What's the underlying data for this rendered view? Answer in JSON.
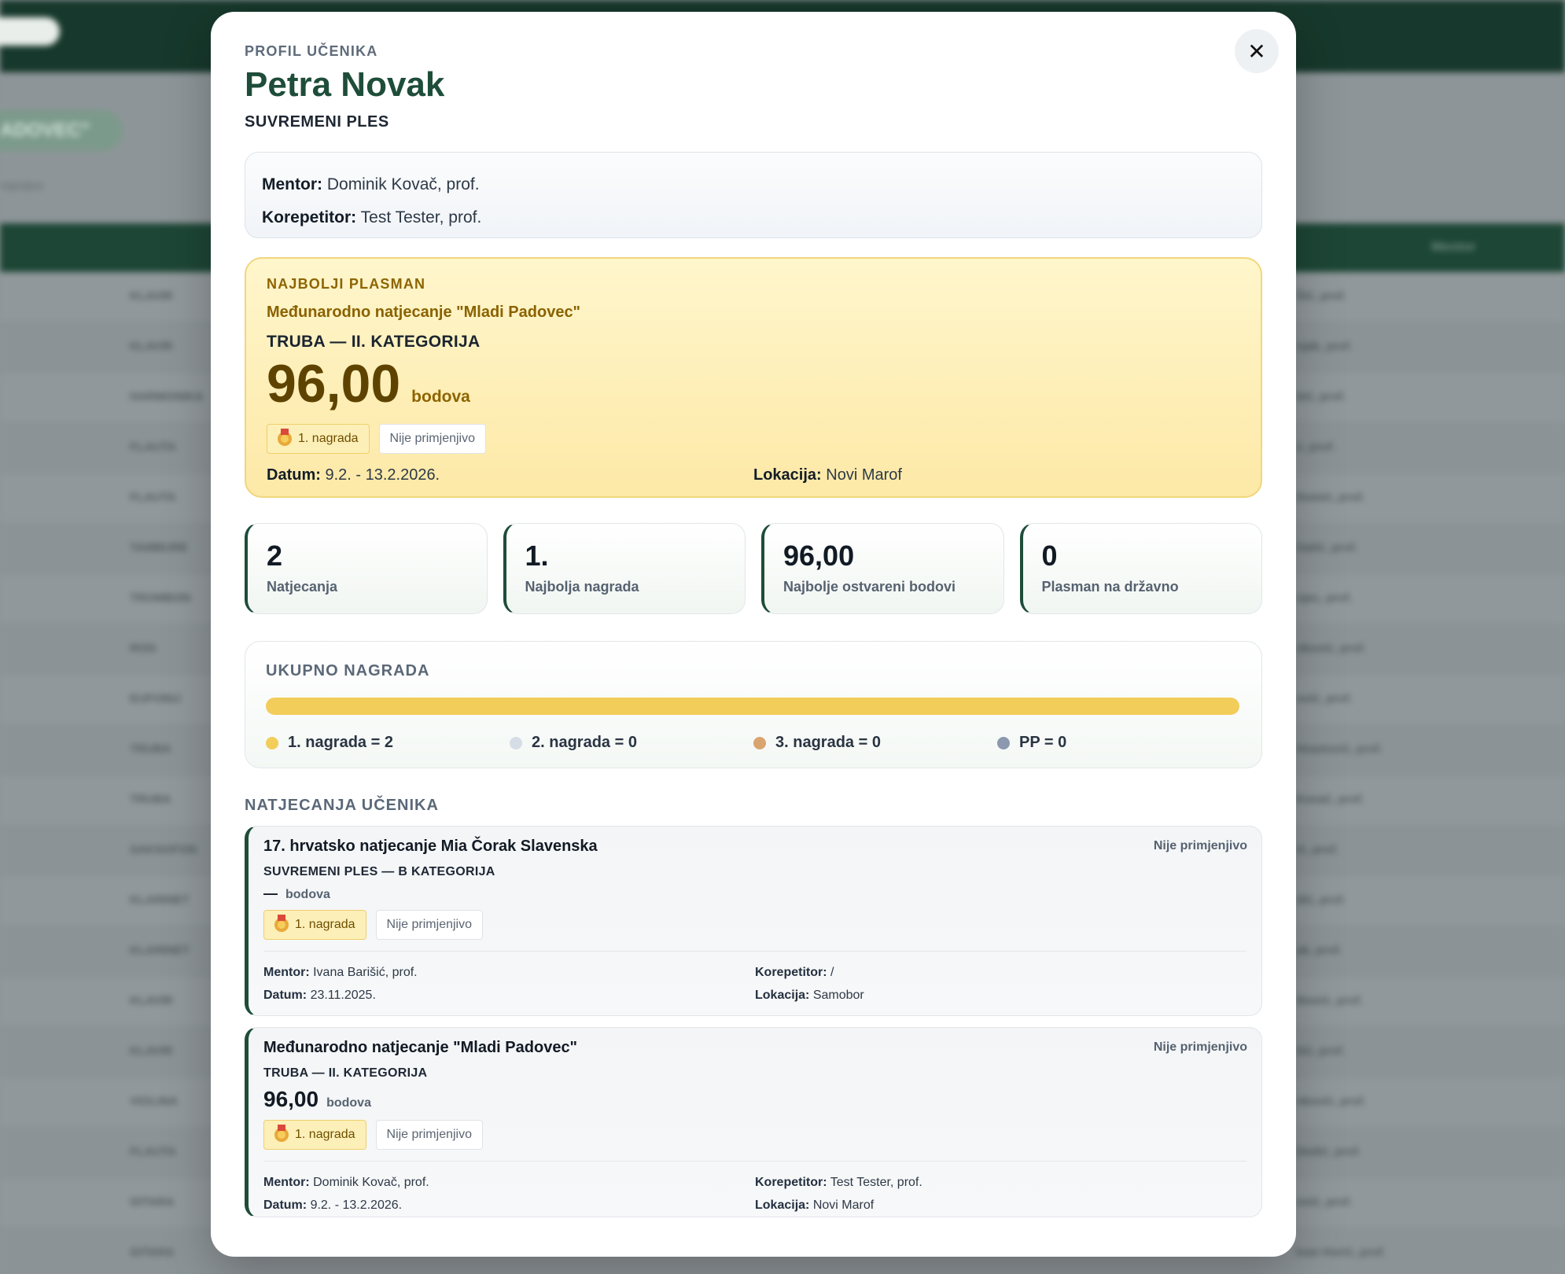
{
  "background": {
    "pill_text": "",
    "badge_text": "ADOVEC\"",
    "sub_text": "mjenjivo",
    "col_header_left": "",
    "col_header_right": "Mentor",
    "rows": [
      {
        "instrument": "KLAVIR",
        "mentor": "Šić, prof."
      },
      {
        "instrument": "KLAVIR",
        "mentor": "njak, prof."
      },
      {
        "instrument": "HARMONIKA",
        "mentor": "bić, prof."
      },
      {
        "instrument": "FLAUTA",
        "mentor": "ć, prof."
      },
      {
        "instrument": "FLAUTA",
        "mentor": "Domić, prof."
      },
      {
        "instrument": "TAMBURE",
        "mentor": "Galić, prof."
      },
      {
        "instrument": "TROMBON",
        "mentor": "njec, prof."
      },
      {
        "instrument": "ROG",
        "mentor": "nković, prof."
      },
      {
        "instrument": "EUFONIJ",
        "mentor": "ović, prof."
      },
      {
        "instrument": "TRUBA",
        "mentor": "Hrastović, prof."
      },
      {
        "instrument": "TRUBA",
        "mentor": "Kovač, prof."
      },
      {
        "instrument": "SAKSOFON",
        "mentor": "ić, prof."
      },
      {
        "instrument": "KLARINET",
        "mentor": "dić, prof."
      },
      {
        "instrument": "KLARINET",
        "mentor": "ak, prof."
      },
      {
        "instrument": "KLAVIR",
        "mentor": "tković, prof."
      },
      {
        "instrument": "KLAVIR",
        "mentor": "šić, prof."
      },
      {
        "instrument": "VIOLINA",
        "mentor": "nković, prof."
      },
      {
        "instrument": "FLAUTA",
        "mentor": "Dedić, prof."
      },
      {
        "instrument": "GITARA",
        "mentor": "ović, prof."
      },
      {
        "instrument": "GITARA",
        "mentor": "Ivan Horić, prof."
      }
    ]
  },
  "modal": {
    "kicker": "PROFIL UČENIKA",
    "name": "Petra Novak",
    "discipline": "SUVREMENI PLES",
    "close_symbol": "✕",
    "info": {
      "mentor_label": "Mentor:",
      "mentor_value": "Dominik Kovač, prof.",
      "korepetitor_label": "Korepetitor:",
      "korepetitor_value": "Test Tester, prof."
    },
    "best": {
      "kicker": "NAJBOLJI PLASMAN",
      "competition": "Međunarodno natjecanje \"Mladi Padovec\"",
      "category": "TRUBA — II. KATEGORIJA",
      "score": "96,00",
      "unit": "bodova",
      "award_chip": "1. nagrada",
      "status_chip": "Nije primjenjivo",
      "date_label": "Datum:",
      "date_value": "9.2. - 13.2.2026.",
      "location_label": "Lokacija:",
      "location_value": "Novi Marof"
    },
    "stats": [
      {
        "value": "2",
        "label": "Natjecanja"
      },
      {
        "value": "1.",
        "label": "Najbolja nagrada"
      },
      {
        "value": "96,00",
        "label": "Najbolje ostvareni bodovi"
      },
      {
        "value": "0",
        "label": "Plasman na državno"
      }
    ],
    "totals": {
      "title": "UKUPNO NAGRADA",
      "first_share": 1.0,
      "legend": [
        {
          "label": "1. nagrada = 2",
          "color": "#f2cd5a"
        },
        {
          "label": "2. nagrada = 0",
          "color": "#d6dde6"
        },
        {
          "label": "3. nagrada = 0",
          "color": "#d9a46f"
        },
        {
          "label": "PP = 0",
          "color": "#8c98ad"
        }
      ]
    },
    "competitions_title": "NATJECANJA UČENIKA",
    "competitions": [
      {
        "name": "17. hrvatsko natjecanje Mia Čorak Slavenska",
        "status": "Nije primjenjivo",
        "category": "SUVREMENI PLES — B KATEGORIJA",
        "score": "—",
        "unit": "bodova",
        "award_chip": "1. nagrada",
        "status_chip": "Nije primjenjivo",
        "mentor_label": "Mentor:",
        "mentor_value": "Ivana Barišić, prof.",
        "date_label": "Datum:",
        "date_value": "23.11.2025.",
        "korepetitor_label": "Korepetitor:",
        "korepetitor_value": "/",
        "location_label": "Lokacija:",
        "location_value": "Samobor"
      },
      {
        "name": "Međunarodno natjecanje \"Mladi Padovec\"",
        "status": "Nije primjenjivo",
        "category": "TRUBA — II. KATEGORIJA",
        "score": "96,00",
        "unit": "bodova",
        "award_chip": "1. nagrada",
        "status_chip": "Nije primjenjivo",
        "mentor_label": "Mentor:",
        "mentor_value": "Dominik Kovač, prof.",
        "date_label": "Datum:",
        "date_value": "9.2. - 13.2.2026.",
        "korepetitor_label": "Korepetitor:",
        "korepetitor_value": "Test Tester, prof.",
        "location_label": "Lokacija:",
        "location_value": "Novi Marof"
      }
    ]
  }
}
